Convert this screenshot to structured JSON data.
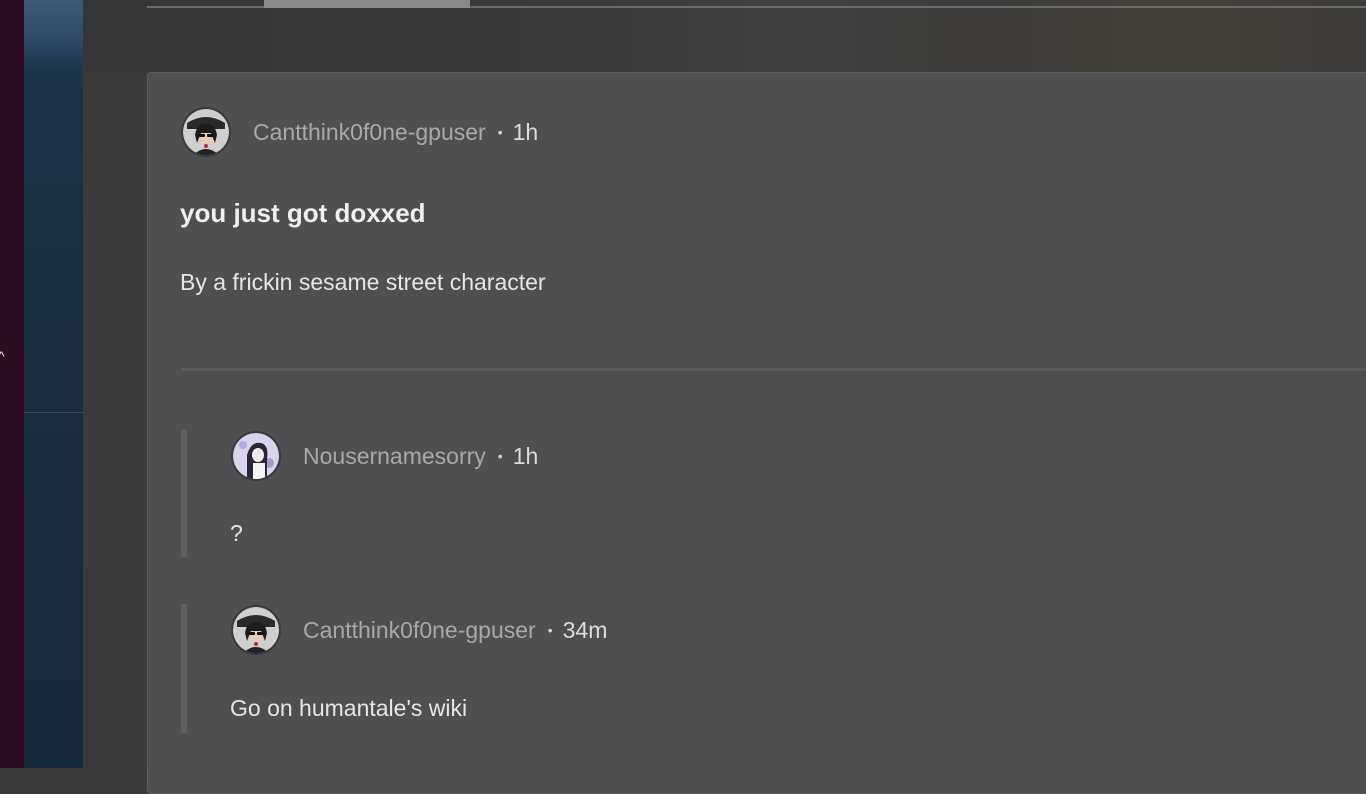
{
  "post": {
    "author": "Cantthink0f0ne-gpuser",
    "separator": "•",
    "time": "1h",
    "title": "you just got doxxed",
    "body": "By a frickin sesame street character"
  },
  "comments": [
    {
      "author": "Nousernamesorry",
      "separator": "•",
      "time": "1h",
      "body": "?"
    },
    {
      "author": "Cantthink0f0ne-gpuser",
      "separator": "•",
      "time": "34m",
      "body": "Go on humantale's wiki"
    }
  ],
  "colors": {
    "card": "#4f4f4f",
    "background": "#3b3b3b",
    "sidebar_dark": "#2a0f22",
    "author_text": "#a9a9a9"
  },
  "icons": {
    "avatar_post": "avatar-icon",
    "avatar_comment_1": "avatar-icon",
    "avatar_comment_2": "avatar-icon"
  }
}
